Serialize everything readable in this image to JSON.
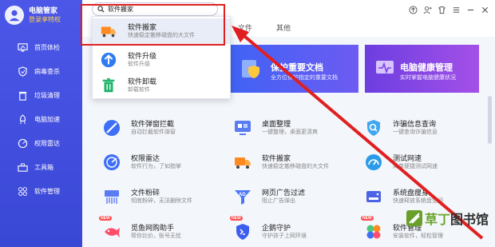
{
  "brand": {
    "title": "电脑管家",
    "subtitle": "登录享特权"
  },
  "sidebar": {
    "items": [
      {
        "label": "首页体检",
        "icon": "monitor-icon"
      },
      {
        "label": "病毒查杀",
        "icon": "shield-icon"
      },
      {
        "label": "垃圾清理",
        "icon": "trash-icon"
      },
      {
        "label": "电脑加速",
        "icon": "rocket-icon"
      },
      {
        "label": "权限雷达",
        "icon": "radar-icon"
      },
      {
        "label": "工具箱",
        "icon": "toolbox-icon"
      },
      {
        "label": "软件管理",
        "icon": "apps-icon"
      }
    ]
  },
  "search": {
    "value": "软件搬家"
  },
  "tabs": [
    "文件",
    "其他"
  ],
  "dropdown": [
    {
      "title": "软件搬家",
      "subtitle": "快速稳定搬移磁盘的大文件",
      "icon": "truck-icon"
    },
    {
      "title": "软件升级",
      "subtitle": "软件升级",
      "icon": "upgrade-icon"
    },
    {
      "title": "软件卸载",
      "subtitle": "卸载软件",
      "icon": "uninstall-icon"
    }
  ],
  "banners": [
    {
      "title": "保护重要文档",
      "subtitle": "全方位保护指定的重要文档"
    },
    {
      "title": "电脑健康管理",
      "subtitle": "实时掌握电脑健康状况"
    }
  ],
  "tools": [
    {
      "name": "软件弹窗拦截",
      "desc": "自动拦截软件弹窗",
      "icon": "popup-block-icon",
      "color": "#3d6ef5"
    },
    {
      "name": "桌面整理",
      "desc": "一键整理，桌面更清爽",
      "icon": "desktop-icon",
      "color": "#5a7cf2"
    },
    {
      "name": "诈骗信息查询",
      "desc": "一键查询诈骗信息",
      "icon": "fraud-search-icon",
      "color": "#3fa7ee"
    },
    {
      "name": "权限雷达",
      "desc": "软件行为，了如指掌",
      "icon": "radar-icon",
      "color": "#3d6ef5"
    },
    {
      "name": "软件搬家",
      "desc": "快速稳定搬移磁盘的大文件",
      "icon": "truck-icon",
      "color": "#ff8a1f"
    },
    {
      "name": "测试网速",
      "desc": "简单便捷测试网速",
      "icon": "speed-icon",
      "color": "#2a9be8"
    },
    {
      "name": "文件粉碎",
      "desc": "彻底粉碎，无法删除文件",
      "icon": "shredder-icon",
      "color": "#5a7cf2"
    },
    {
      "name": "网页广告过滤",
      "desc": "阻止广告弹出",
      "icon": "ad-filter-icon",
      "color": "#4a78f5"
    },
    {
      "name": "系统盘瘦身",
      "desc": "快速释放系统盘空间",
      "icon": "disk-icon",
      "color": "#4d63e6"
    },
    {
      "name": "觅鱼网购助手",
      "desc": "帮你比价，账号无忧",
      "icon": "shopping-icon",
      "color": "#ff4d6a"
    },
    {
      "name": "企鹅守护",
      "desc": "守护孩子上网环境",
      "icon": "guard-icon",
      "color": "#3b5ef0"
    },
    {
      "name": "软件管理",
      "desc": "安装软件，轻松管理",
      "icon": "apps-icon",
      "color": "#4ac97a"
    }
  ],
  "badge": "NEW",
  "watermark": {
    "part1": "草丁",
    "part2": "图书馆"
  },
  "colors": {
    "sidebar": "#4350e0",
    "accent": "#3d6ef5",
    "highlight": "#e02020"
  }
}
